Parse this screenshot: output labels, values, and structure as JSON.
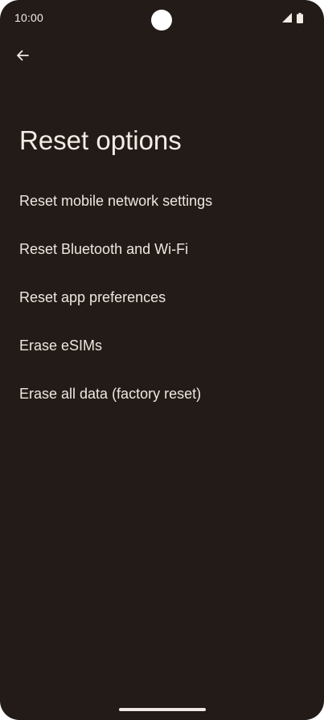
{
  "status_bar": {
    "time": "10:00",
    "icons": [
      "signal-icon",
      "battery-icon"
    ]
  },
  "header": {
    "back_icon": "arrow-back-icon",
    "title": "Reset options"
  },
  "options": [
    {
      "label": "Reset mobile network settings"
    },
    {
      "label": "Reset Bluetooth and Wi-Fi"
    },
    {
      "label": "Reset app preferences"
    },
    {
      "label": "Erase eSIMs"
    },
    {
      "label": "Erase all data (factory reset)"
    }
  ],
  "colors": {
    "background": "#221b17",
    "text": "#f3ece6"
  }
}
